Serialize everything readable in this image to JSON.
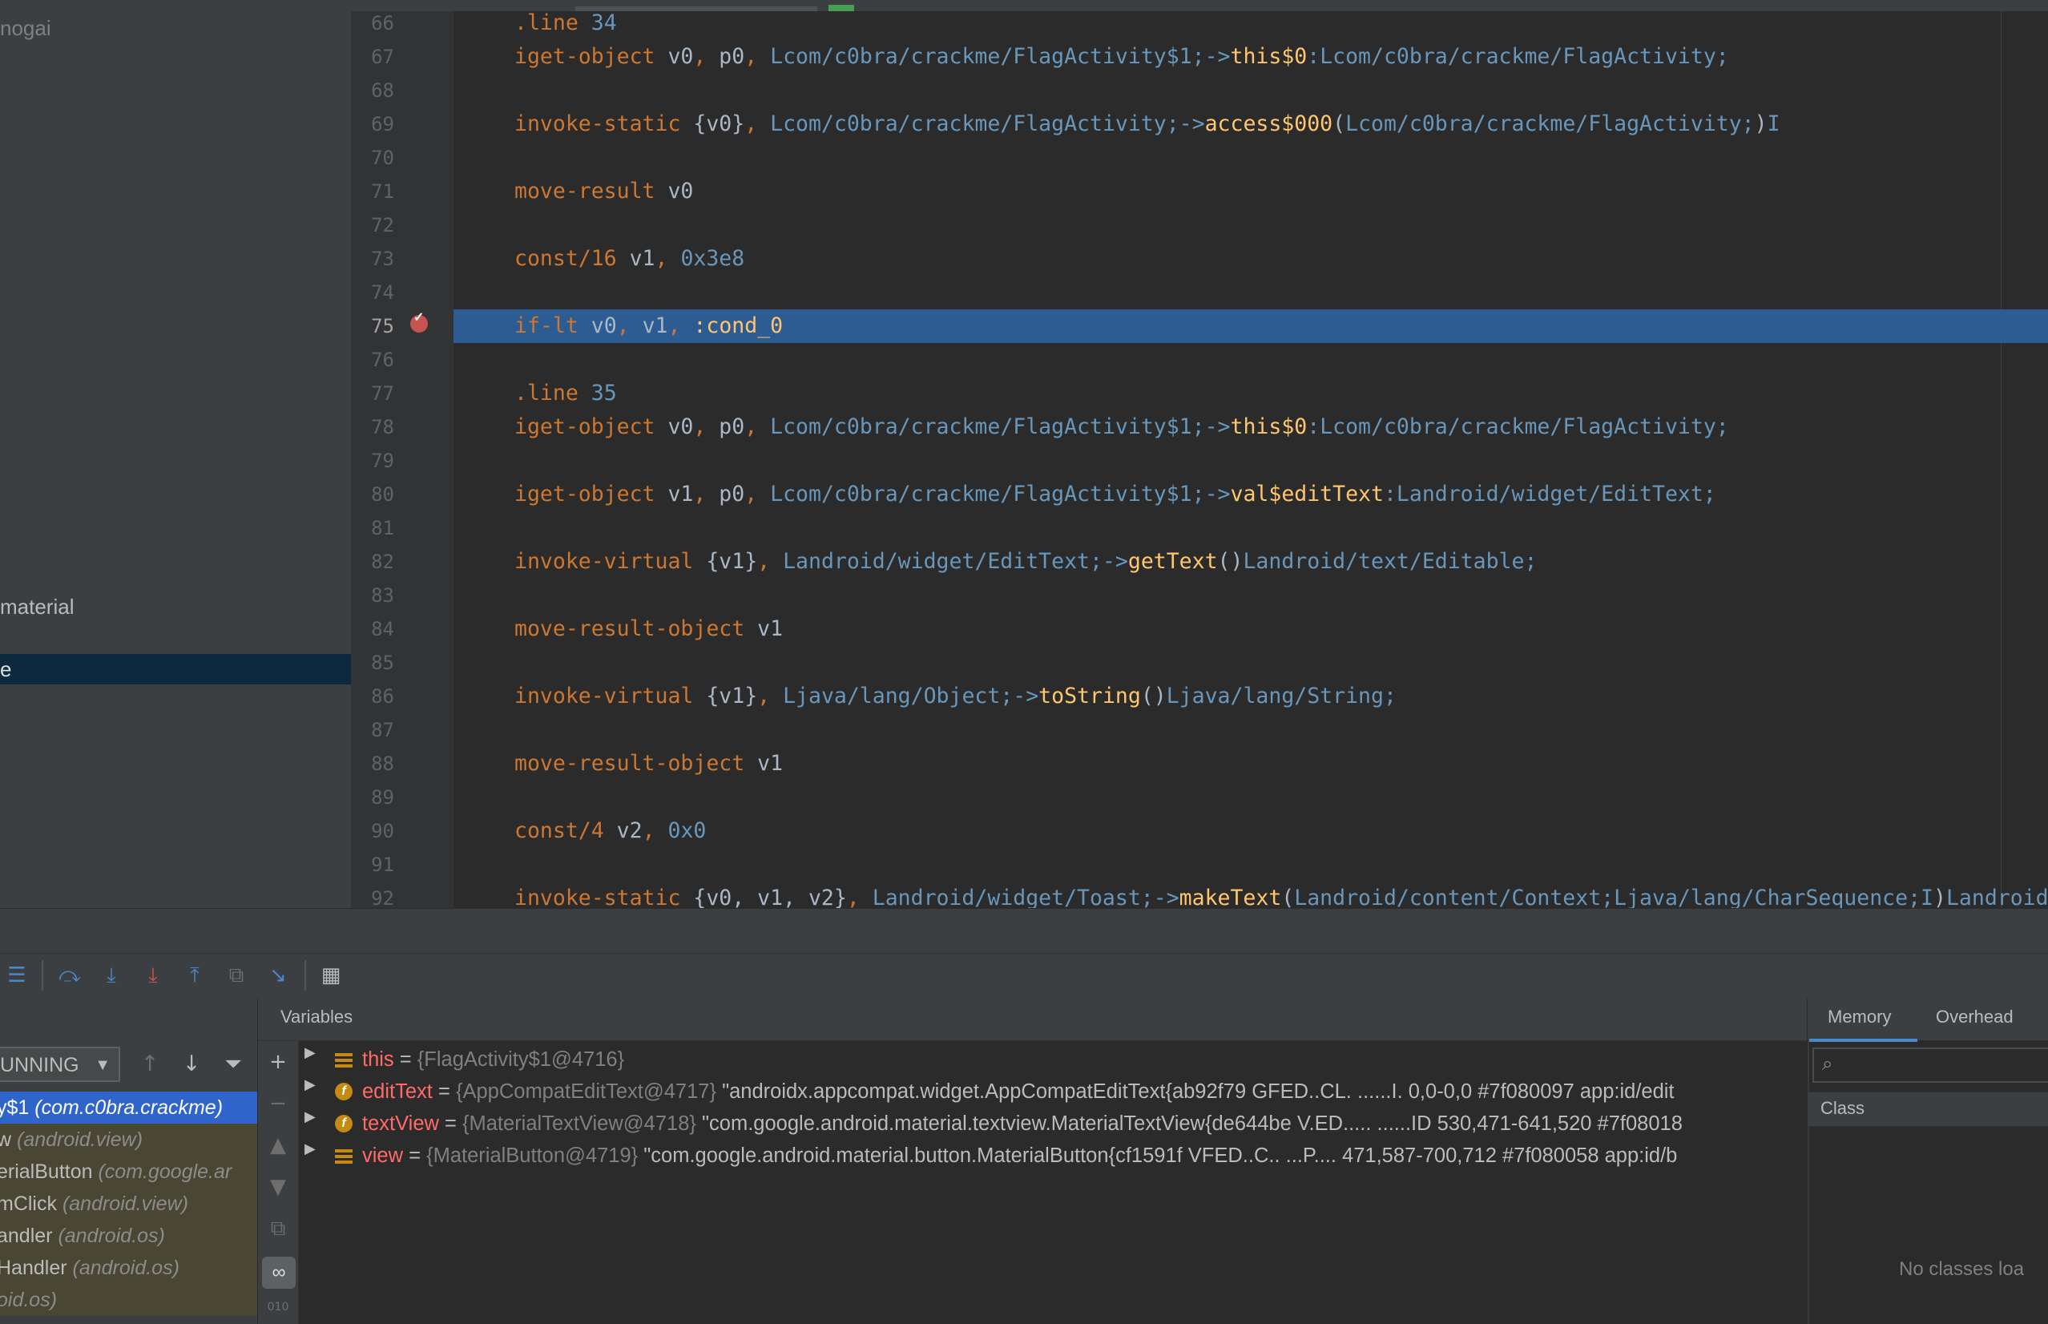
{
  "project_tree": {
    "items": [
      {
        "label": "nogai"
      },
      {
        "label": "material"
      },
      {
        "label": "e"
      }
    ]
  },
  "editor": {
    "lines": [
      {
        "num": "66",
        "tokens": [
          [
            "kw",
            ".line "
          ],
          [
            "num",
            "34"
          ]
        ]
      },
      {
        "num": "67",
        "tokens": [
          [
            "kw",
            "iget-object "
          ],
          [
            "reg",
            "v0"
          ],
          [
            "punc",
            ", "
          ],
          [
            "reg",
            "p0"
          ],
          [
            "punc",
            ", "
          ],
          [
            "cls",
            "Lcom/c0bra/crackme/FlagActivity$1;->"
          ],
          [
            "mem",
            "this$0"
          ],
          [
            "cls",
            ":Lcom/c0bra/crackme/FlagActivity;"
          ]
        ]
      },
      {
        "num": "68",
        "tokens": []
      },
      {
        "num": "69",
        "tokens": [
          [
            "kw",
            "invoke-static "
          ],
          [
            "reg",
            "{v0}"
          ],
          [
            "punc",
            ", "
          ],
          [
            "cls",
            "Lcom/c0bra/crackme/FlagActivity;->"
          ],
          [
            "mem",
            "access$000"
          ],
          [
            "reg",
            "("
          ],
          [
            "cls",
            "Lcom/c0bra/crackme/FlagActivity;"
          ],
          [
            "reg",
            ")"
          ],
          [
            "cls",
            "I"
          ]
        ]
      },
      {
        "num": "70",
        "tokens": []
      },
      {
        "num": "71",
        "tokens": [
          [
            "kw",
            "move-result "
          ],
          [
            "reg",
            "v0"
          ]
        ]
      },
      {
        "num": "72",
        "tokens": []
      },
      {
        "num": "73",
        "tokens": [
          [
            "kw",
            "const/16 "
          ],
          [
            "reg",
            "v1"
          ],
          [
            "punc",
            ", "
          ],
          [
            "num",
            "0x3e8"
          ]
        ]
      },
      {
        "num": "74",
        "tokens": []
      },
      {
        "num": "75",
        "tokens": [
          [
            "kw",
            "if-lt "
          ],
          [
            "reg",
            "v0"
          ],
          [
            "punc",
            ", "
          ],
          [
            "reg",
            "v1"
          ],
          [
            "punc",
            ", "
          ],
          [
            "lbl",
            ":cond_0"
          ]
        ],
        "highlight": true
      },
      {
        "num": "76",
        "tokens": []
      },
      {
        "num": "77",
        "tokens": [
          [
            "kw",
            ".line "
          ],
          [
            "num",
            "35"
          ]
        ]
      },
      {
        "num": "78",
        "tokens": [
          [
            "kw",
            "iget-object "
          ],
          [
            "reg",
            "v0"
          ],
          [
            "punc",
            ", "
          ],
          [
            "reg",
            "p0"
          ],
          [
            "punc",
            ", "
          ],
          [
            "cls",
            "Lcom/c0bra/crackme/FlagActivity$1;->"
          ],
          [
            "mem",
            "this$0"
          ],
          [
            "cls",
            ":Lcom/c0bra/crackme/FlagActivity;"
          ]
        ]
      },
      {
        "num": "79",
        "tokens": []
      },
      {
        "num": "80",
        "tokens": [
          [
            "kw",
            "iget-object "
          ],
          [
            "reg",
            "v1"
          ],
          [
            "punc",
            ", "
          ],
          [
            "reg",
            "p0"
          ],
          [
            "punc",
            ", "
          ],
          [
            "cls",
            "Lcom/c0bra/crackme/FlagActivity$1;->"
          ],
          [
            "mem",
            "val$editText"
          ],
          [
            "cls",
            ":Landroid/widget/EditText;"
          ]
        ]
      },
      {
        "num": "81",
        "tokens": []
      },
      {
        "num": "82",
        "tokens": [
          [
            "kw",
            "invoke-virtual "
          ],
          [
            "reg",
            "{v1}"
          ],
          [
            "punc",
            ", "
          ],
          [
            "cls",
            "Landroid/widget/EditText;->"
          ],
          [
            "mem",
            "getText"
          ],
          [
            "reg",
            "()"
          ],
          [
            "cls",
            "Landroid/text/Editable;"
          ]
        ]
      },
      {
        "num": "83",
        "tokens": []
      },
      {
        "num": "84",
        "tokens": [
          [
            "kw",
            "move-result-object "
          ],
          [
            "reg",
            "v1"
          ]
        ]
      },
      {
        "num": "85",
        "tokens": []
      },
      {
        "num": "86",
        "tokens": [
          [
            "kw",
            "invoke-virtual "
          ],
          [
            "reg",
            "{v1}"
          ],
          [
            "punc",
            ", "
          ],
          [
            "cls",
            "Ljava/lang/Object;->"
          ],
          [
            "mem",
            "toString"
          ],
          [
            "reg",
            "()"
          ],
          [
            "cls",
            "Ljava/lang/String;"
          ]
        ]
      },
      {
        "num": "87",
        "tokens": []
      },
      {
        "num": "88",
        "tokens": [
          [
            "kw",
            "move-result-object "
          ],
          [
            "reg",
            "v1"
          ]
        ]
      },
      {
        "num": "89",
        "tokens": []
      },
      {
        "num": "90",
        "tokens": [
          [
            "kw",
            "const/4 "
          ],
          [
            "reg",
            "v2"
          ],
          [
            "punc",
            ", "
          ],
          [
            "num",
            "0x0"
          ]
        ]
      },
      {
        "num": "91",
        "tokens": []
      },
      {
        "num": "92",
        "tokens": [
          [
            "kw",
            "invoke-static "
          ],
          [
            "reg",
            "{v0, v1, v2}"
          ],
          [
            "punc",
            ", "
          ],
          [
            "cls",
            "Landroid/widget/Toast;->"
          ],
          [
            "mem",
            "makeText"
          ],
          [
            "reg",
            "("
          ],
          [
            "cls",
            "Landroid/content/Context;Ljava/lang/CharSequence;I"
          ],
          [
            "reg",
            ")"
          ],
          [
            "cls",
            "Landroid/widget/Toast;"
          ]
        ]
      }
    ]
  },
  "debug": {
    "toolbar_icons": [
      "menu-icon",
      "step-over-icon",
      "step-into-icon",
      "force-step-into-icon",
      "step-out-icon",
      "drop-frame-icon",
      "run-to-cursor-icon",
      "evaluate-expression-icon"
    ],
    "thread_select": {
      "value": "UNNING"
    },
    "frames": [
      {
        "name": "y$1",
        "pkg": " (com.c0bra.crackme)",
        "selected": true
      },
      {
        "name": "w",
        "pkg": " (android.view)"
      },
      {
        "name": "erialButton",
        "pkg": " (com.google.ar"
      },
      {
        "name": "mClick",
        "pkg": " (android.view)"
      },
      {
        "name": "andler",
        "pkg": " (android.os)"
      },
      {
        "name": "Handler",
        "pkg": " (android.os)"
      },
      {
        "name": "",
        "pkg": "oid.os)"
      }
    ],
    "variables_title": "Variables",
    "variables": [
      {
        "kind": "local",
        "name": "this",
        "type": "{FlagActivity$1@4716}",
        "value": ""
      },
      {
        "kind": "field",
        "name": "editText",
        "type": "{AppCompatEditText@4717}",
        "value": "\"androidx.appcompat.widget.AppCompatEditText{ab92f79 GFED..CL. ......I. 0,0-0,0 #7f080097 app:id/edit"
      },
      {
        "kind": "field",
        "name": "textView",
        "type": "{MaterialTextView@4718}",
        "value": "\"com.google.android.material.textview.MaterialTextView{de644be V.ED..... ......ID 530,471-641,520 #7f08018"
      },
      {
        "kind": "local",
        "name": "view",
        "type": "{MaterialButton@4719}",
        "value": "\"com.google.android.material.button.MaterialButton{cf1591f VFED..C.. ...P.... 471,587-700,712 #7f080058 app:id/b"
      }
    ],
    "memory": {
      "tabs": [
        "Memory",
        "Overhead"
      ],
      "class_header": "Class",
      "empty_text": "No classes loa"
    }
  }
}
